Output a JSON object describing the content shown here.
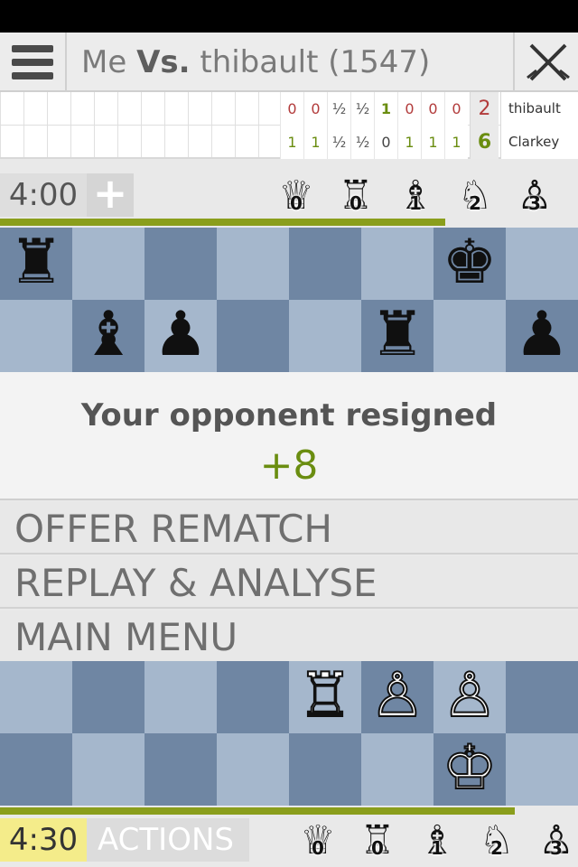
{
  "header": {
    "title_player": "Me",
    "title_vs": "Vs.",
    "title_opponent": "thibault (1547)"
  },
  "score_table": {
    "rows": [
      {
        "scores": [
          "0",
          "0",
          "½",
          "½",
          "1",
          "0",
          "0",
          "0"
        ],
        "total": "2",
        "name": "thibault"
      },
      {
        "scores": [
          "1",
          "1",
          "½",
          "½",
          "0",
          "1",
          "1",
          "1"
        ],
        "total": "6",
        "name": "Clarkey"
      }
    ]
  },
  "opponent": {
    "clock": "4:00",
    "plus_label": "+",
    "time_fraction": 0.77,
    "captured": [
      {
        "icon": "queen-icon",
        "glyph": "♕",
        "count": "0"
      },
      {
        "icon": "rook-icon",
        "glyph": "♖",
        "count": "0"
      },
      {
        "icon": "bishop-icon",
        "glyph": "♗",
        "count": "1"
      },
      {
        "icon": "knight-icon",
        "glyph": "♘",
        "count": "2"
      },
      {
        "icon": "pawn-icon",
        "glyph": "♙",
        "count": "3"
      }
    ]
  },
  "top_board": [
    [
      "♜",
      "",
      "",
      "",
      "",
      "",
      "♚",
      ""
    ],
    [
      "",
      "♝",
      "♟",
      "",
      "",
      "♜",
      "",
      "♟"
    ]
  ],
  "result": {
    "message": "Your opponent resigned",
    "score": "+8"
  },
  "menu": {
    "offer_rematch": "OFFER REMATCH",
    "replay_analyse": "REPLAY & ANALYSE",
    "main_menu": "MAIN MENU"
  },
  "bottom_board": [
    [
      "",
      "",
      "",
      "",
      "♖",
      "♙",
      "♙",
      ""
    ],
    [
      "",
      "",
      "",
      "",
      "",
      "",
      "♔",
      ""
    ]
  ],
  "me": {
    "clock": "4:30",
    "actions_label": "ACTIONS",
    "time_fraction": 0.89,
    "captured": [
      {
        "icon": "queen-icon",
        "glyph": "♕",
        "count": "0"
      },
      {
        "icon": "rook-icon",
        "glyph": "♖",
        "count": "0"
      },
      {
        "icon": "bishop-icon",
        "glyph": "♗",
        "count": "1"
      },
      {
        "icon": "knight-icon",
        "glyph": "♘",
        "count": "2"
      },
      {
        "icon": "pawn-icon",
        "glyph": "♙",
        "count": "3"
      }
    ]
  },
  "colors": {
    "accent_green": "#6a8d10",
    "loss_red": "#b23b3b",
    "active_clock": "#f4ec8a"
  }
}
